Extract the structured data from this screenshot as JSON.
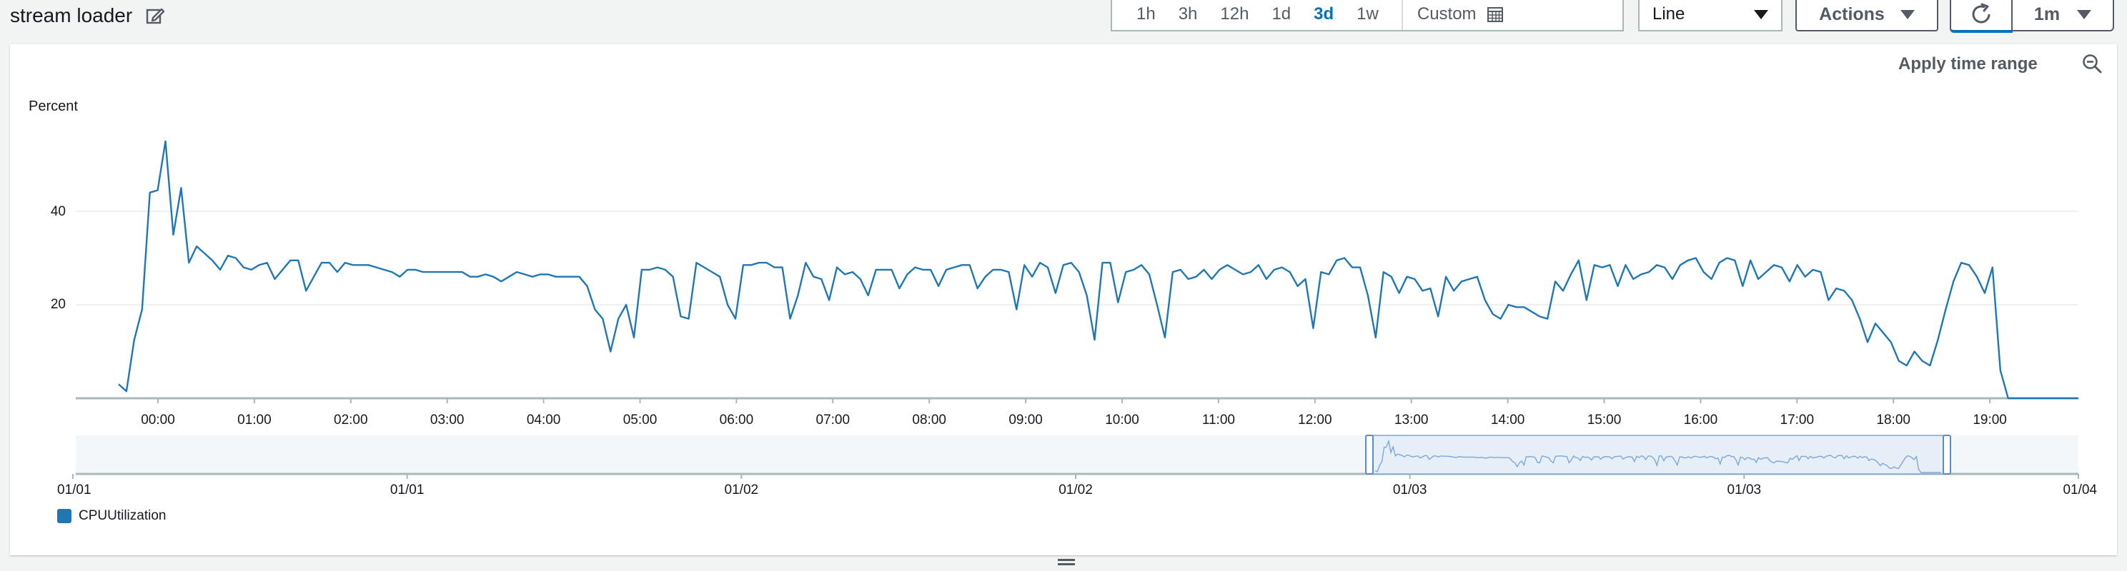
{
  "widget": {
    "title": "stream loader"
  },
  "time_range": {
    "options": [
      "1h",
      "3h",
      "12h",
      "1d",
      "3d",
      "1w"
    ],
    "active": "3d",
    "custom_label": "Custom"
  },
  "view_select": {
    "value": "Line"
  },
  "actions": {
    "label": "Actions"
  },
  "refresh": {
    "interval": "1m"
  },
  "panel": {
    "apply_label": "Apply time range"
  },
  "colors": {
    "series": "#1f77b4",
    "active_range": "#0073bb",
    "border": "#aab7b8"
  },
  "chart_data": {
    "type": "line",
    "ylabel": "Percent",
    "y_ticks": [
      "40",
      "20"
    ],
    "ylim": [
      0,
      60
    ],
    "x_tick_labels": [
      "00:00",
      "01:00",
      "02:00",
      "03:00",
      "04:00",
      "05:00",
      "06:00",
      "07:00",
      "08:00",
      "09:00",
      "10:00",
      "11:00",
      "12:00",
      "13:00",
      "14:00",
      "15:00",
      "16:00",
      "17:00",
      "18:00",
      "19:00"
    ],
    "overview_tick_labels": [
      "01/01",
      "01/01",
      "01/02",
      "01/02",
      "01/03",
      "01/03",
      "01/04"
    ],
    "series": [
      {
        "name": "CPUUtilization",
        "values": [
          3,
          1.5,
          12.5,
          19,
          44,
          44.5,
          55,
          35,
          45,
          29,
          32.5,
          31,
          29.5,
          27.5,
          30.5,
          30,
          28,
          27.5,
          28.5,
          29,
          25.5,
          27.5,
          29.5,
          29.5,
          23,
          26,
          29,
          29,
          27,
          29,
          28.5,
          28.5,
          28.5,
          28,
          27.5,
          27,
          26,
          27.5,
          27.5,
          27,
          27,
          27,
          27,
          27,
          27,
          26,
          26,
          26.5,
          26,
          25,
          26,
          27,
          26.5,
          26,
          26.5,
          26.5,
          26,
          26,
          26,
          26,
          24,
          19,
          17,
          10,
          17,
          20,
          13,
          27.5,
          27.5,
          28,
          27.5,
          26,
          17.5,
          17,
          29,
          28,
          27,
          26,
          20,
          17,
          28.5,
          28.5,
          29,
          29,
          28,
          28,
          17,
          22,
          29,
          26,
          25.5,
          21,
          28,
          26.5,
          27,
          25.5,
          22,
          27.5,
          27.5,
          27.5,
          23.5,
          26.5,
          28,
          27.5,
          27.5,
          24,
          27.5,
          28,
          28.5,
          28.5,
          23.5,
          26,
          27.5,
          27.5,
          27,
          19,
          28.5,
          26,
          29,
          28,
          22.5,
          28.5,
          29,
          27,
          22,
          12.5,
          29,
          29,
          20.5,
          27,
          27.5,
          28.5,
          26.5,
          20,
          13,
          27,
          27.5,
          25.5,
          26,
          27.5,
          25.5,
          27.5,
          28.5,
          27.5,
          26.5,
          27,
          28.5,
          25.5,
          27.5,
          28,
          27,
          24,
          25.5,
          15,
          27,
          26.5,
          29.5,
          30,
          28,
          28,
          22,
          13,
          27,
          26,
          22.5,
          26,
          25.5,
          23,
          23.5,
          17.5,
          26,
          23,
          25,
          25.5,
          26,
          21,
          18,
          17,
          20,
          19.5,
          19.5,
          18.5,
          17.5,
          17,
          25,
          23,
          26.5,
          29.5,
          21,
          28.5,
          28,
          28.5,
          24,
          28.5,
          25.5,
          26.5,
          27,
          28.5,
          28,
          25.5,
          28.5,
          29.5,
          30,
          27,
          25.5,
          29,
          30,
          29.5,
          24,
          29.5,
          25.5,
          27,
          28.5,
          28,
          25,
          28.5,
          26,
          27.5,
          27,
          21,
          23.5,
          23,
          21,
          17,
          12,
          16,
          14,
          12,
          8,
          7,
          10,
          8,
          7,
          12.5,
          19,
          25,
          29,
          28.5,
          26,
          22.5,
          28,
          6,
          0,
          0,
          0,
          0,
          0,
          0,
          0,
          0,
          0,
          0
        ]
      }
    ],
    "legend_placement": "bottom-left",
    "grid": true
  }
}
